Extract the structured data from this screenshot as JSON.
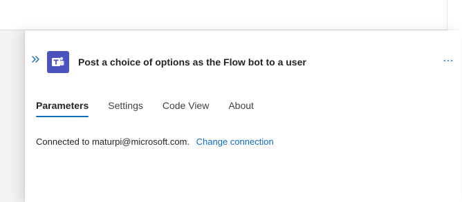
{
  "panel": {
    "title": "Post a choice of options as the Flow bot to a user",
    "collapse_icon": "double-chevron-right-icon",
    "app_icon": "microsoft-teams-icon",
    "more_icon": "more-options-ellipsis-icon",
    "accent_color": "#0f6cbd",
    "app_icon_color": "#4b53bc"
  },
  "tabs": [
    {
      "label": "Parameters",
      "active": true
    },
    {
      "label": "Settings",
      "active": false
    },
    {
      "label": "Code View",
      "active": false
    },
    {
      "label": "About",
      "active": false
    }
  ],
  "connection": {
    "text": "Connected to maturpi@microsoft.com.",
    "link_label": "Change connection"
  }
}
